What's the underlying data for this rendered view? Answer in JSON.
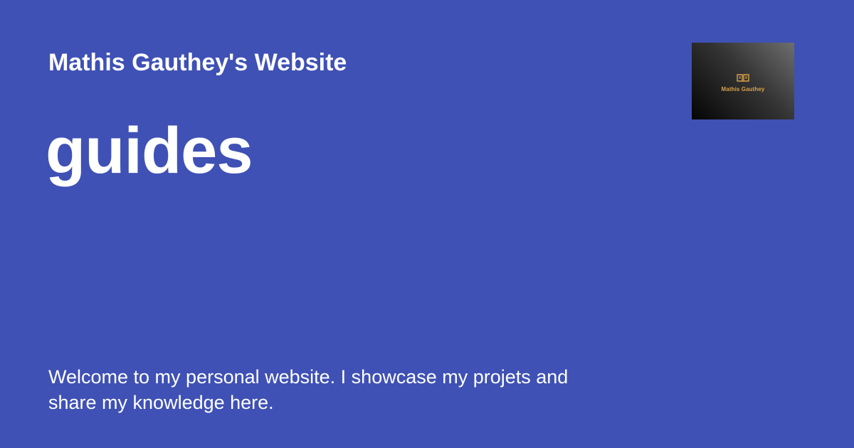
{
  "site": {
    "title": "Mathis Gauthey's Website"
  },
  "page": {
    "title": "guides",
    "description": "Welcome to my personal website. I showcase my projets and share my knowledge here."
  },
  "logo": {
    "text": "Mathis Gauthey",
    "icon": "open-book-icon",
    "accent_color": "#d9a14a"
  },
  "colors": {
    "background": "#3f51b5",
    "text": "#ffffff"
  }
}
